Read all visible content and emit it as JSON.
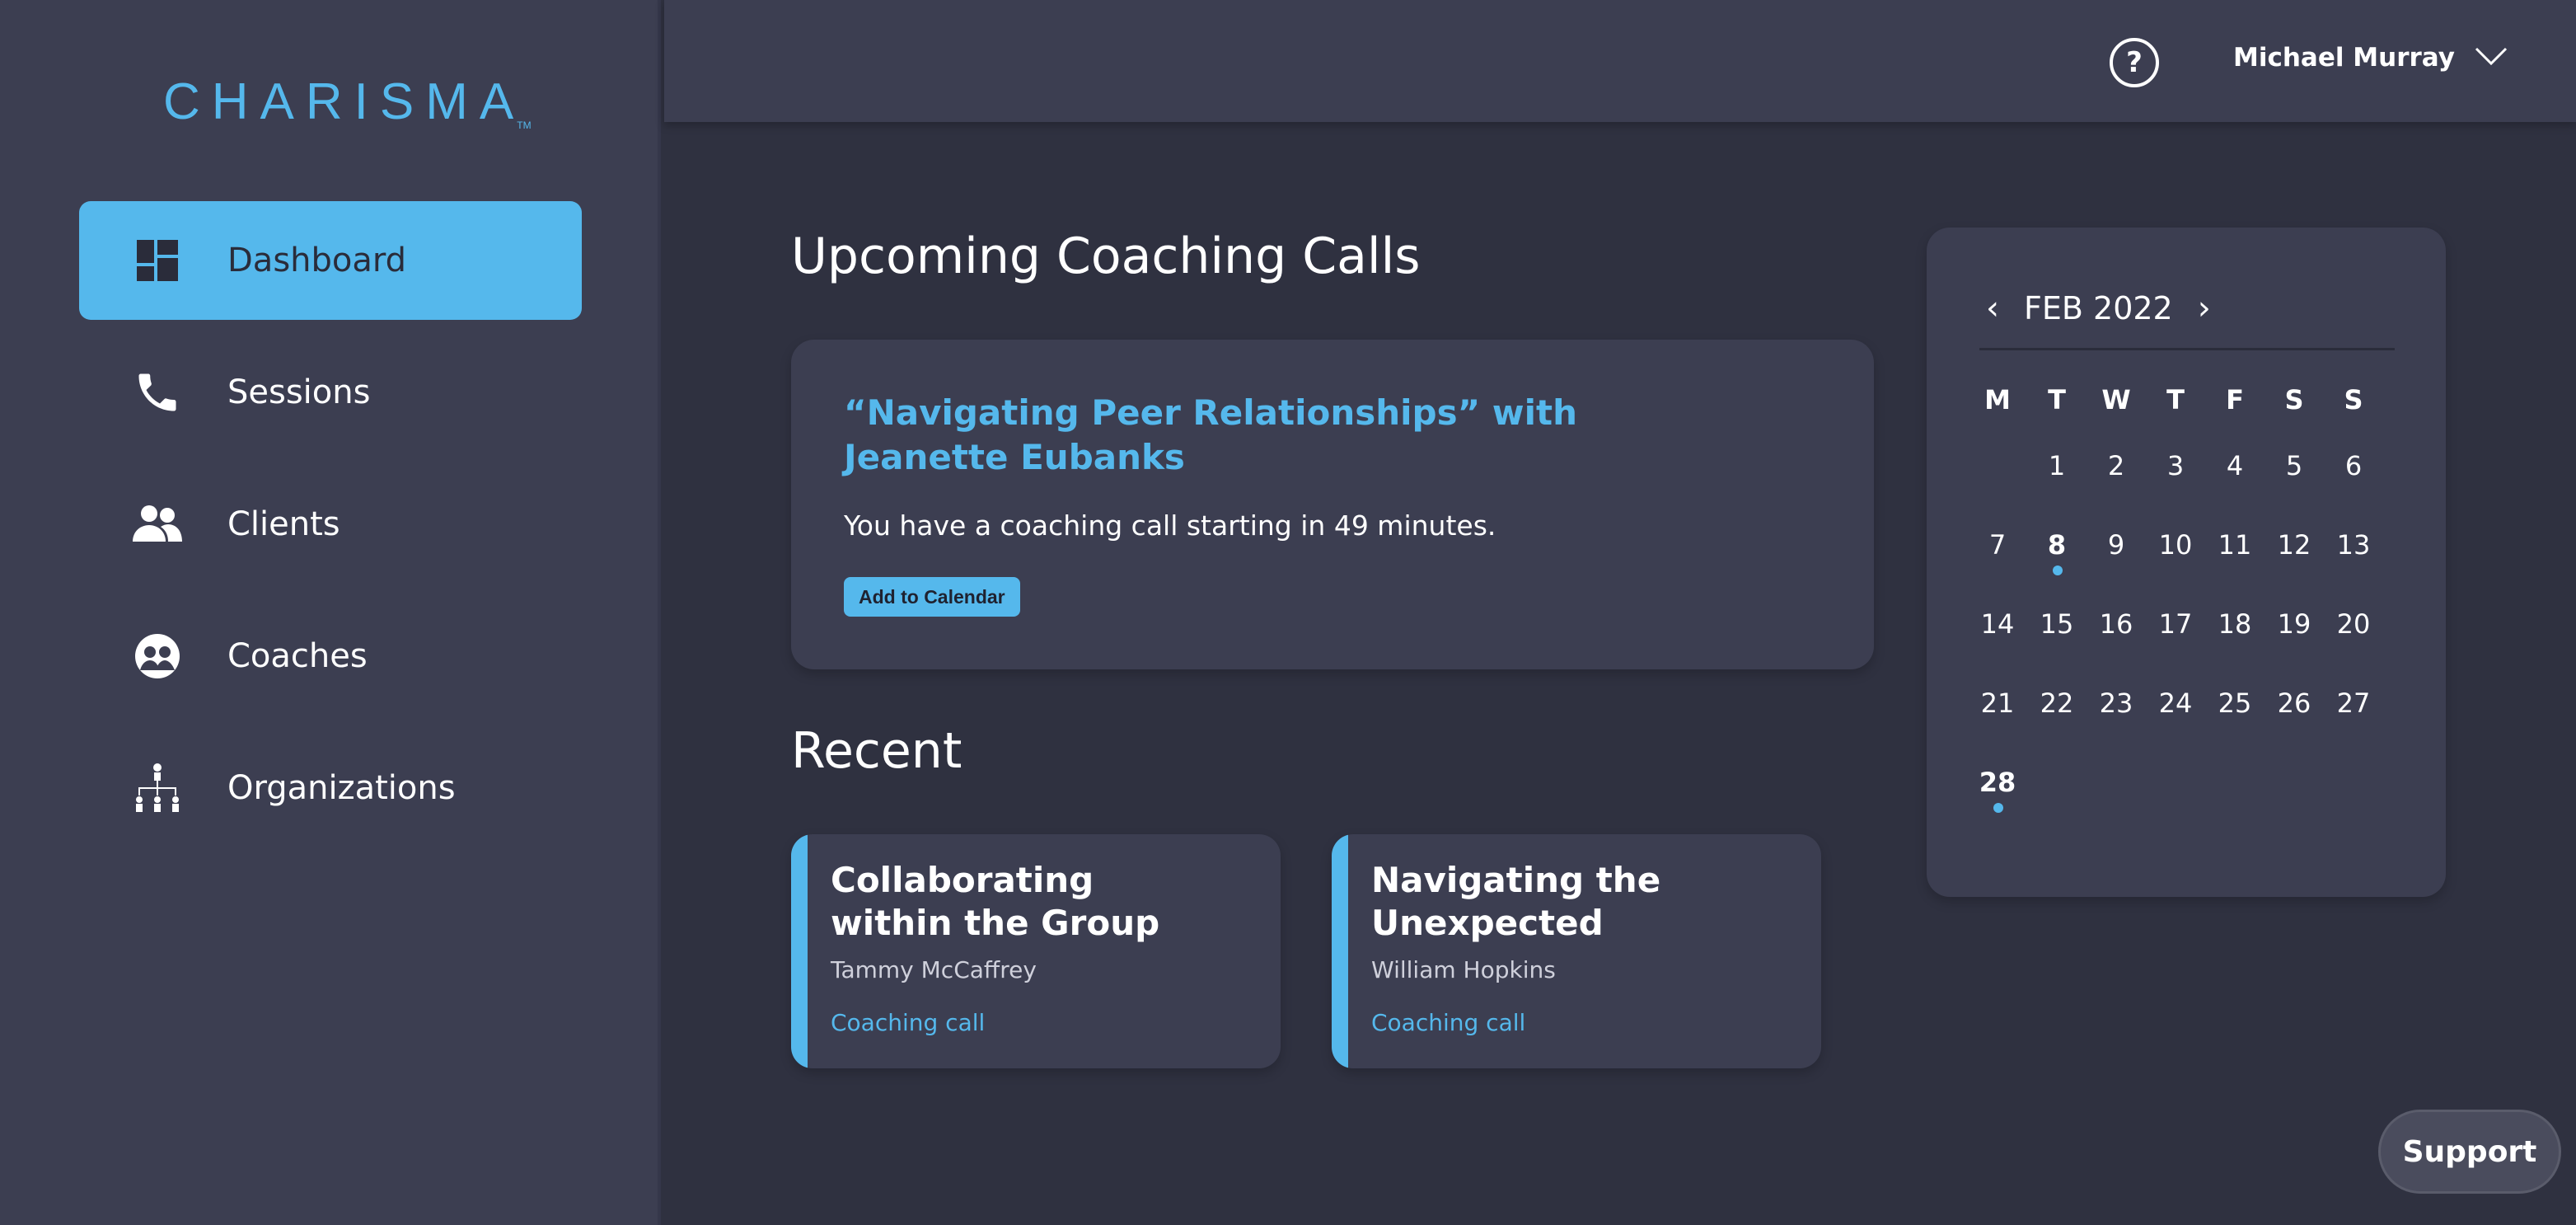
{
  "brand": {
    "name": "CHARISMA",
    "tm": "TM"
  },
  "sidebar": {
    "items": [
      {
        "label": "Dashboard",
        "icon": "dashboard-icon",
        "active": true
      },
      {
        "label": "Sessions",
        "icon": "phone-icon",
        "active": false
      },
      {
        "label": "Clients",
        "icon": "users-icon",
        "active": false
      },
      {
        "label": "Coaches",
        "icon": "coaches-icon",
        "active": false
      },
      {
        "label": "Organizations",
        "icon": "org-chart-icon",
        "active": false
      }
    ]
  },
  "header": {
    "help_icon": "question-circle-icon",
    "user_name": "Michael Murray",
    "user_menu_icon": "chevron-down-icon"
  },
  "main": {
    "upcoming_title": "Upcoming Coaching Calls",
    "upcoming_call": {
      "title": "“Navigating Peer Relationships” with Jeanette Eubanks",
      "message": "You have a coaching call starting in 49 minutes.",
      "button_label": "Add to Calendar"
    },
    "recent_title": "Recent",
    "recent": [
      {
        "title": "Collaborating within the Group",
        "person": "Tammy McCaffrey",
        "type": "Coaching call"
      },
      {
        "title": "Navigating the Unexpected",
        "person": "William Hopkins",
        "type": "Coaching call"
      }
    ]
  },
  "calendar": {
    "month_label": "FEB 2022",
    "prev_label": "‹",
    "next_label": "›",
    "weekdays": [
      "M",
      "T",
      "W",
      "T",
      "F",
      "S",
      "S"
    ],
    "weeks": [
      [
        "",
        "1",
        "2",
        "3",
        "4",
        "5",
        "6"
      ],
      [
        "7",
        "8",
        "9",
        "10",
        "11",
        "12",
        "13"
      ],
      [
        "14",
        "15",
        "16",
        "17",
        "18",
        "19",
        "20"
      ],
      [
        "21",
        "22",
        "23",
        "24",
        "25",
        "26",
        "27"
      ],
      [
        "28",
        "",
        "",
        "",
        "",
        "",
        ""
      ]
    ],
    "marked_days": [
      "8",
      "28"
    ]
  },
  "support": {
    "label": "Support"
  },
  "colors": {
    "accent": "#55b8ec",
    "background": "#2f3140",
    "panel": "#3c3e51"
  }
}
